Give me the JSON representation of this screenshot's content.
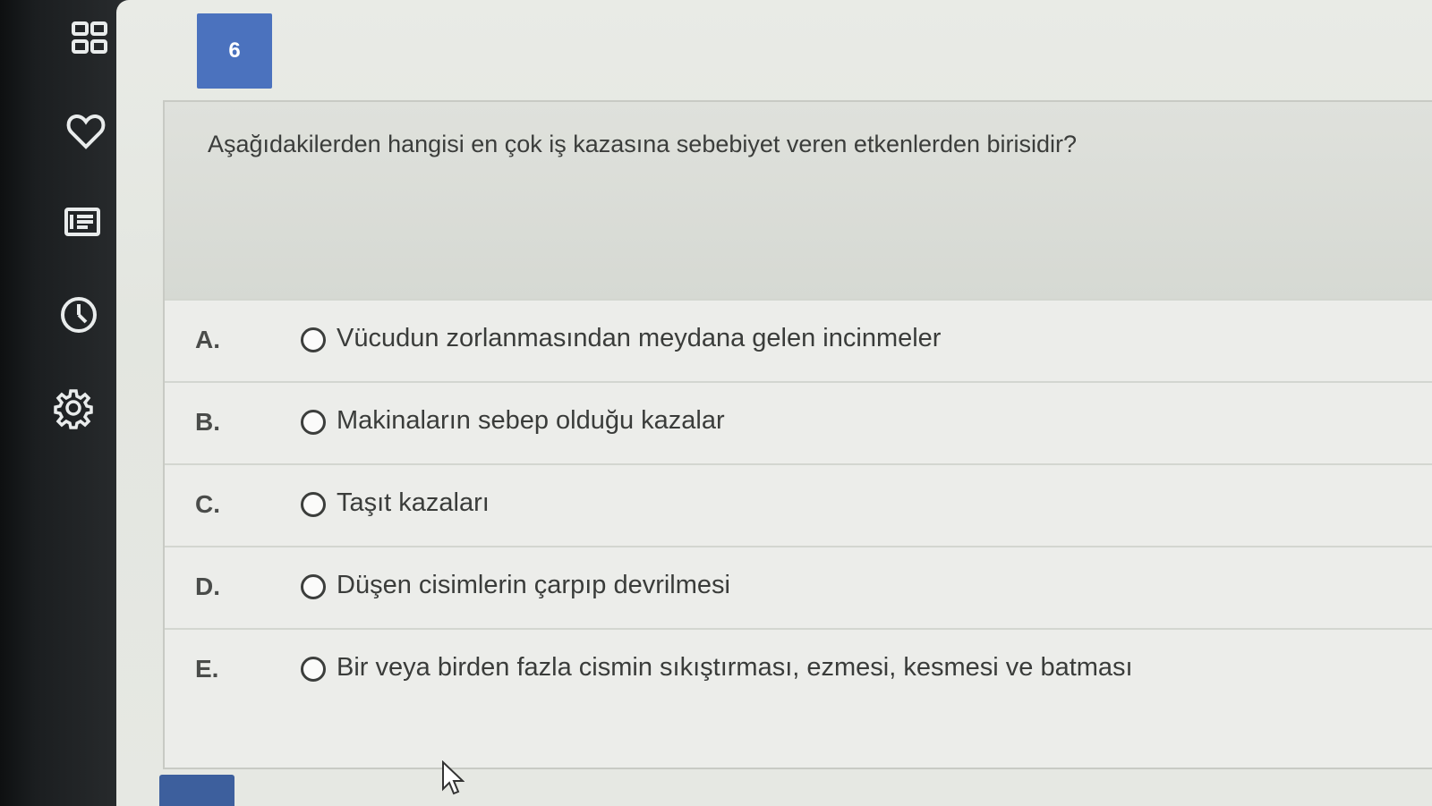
{
  "sidebar": {
    "items": [
      {
        "icon": "grid-icon",
        "name": "dashboard"
      },
      {
        "icon": "heart-icon",
        "name": "favorites"
      },
      {
        "icon": "newspaper-icon",
        "name": "articles"
      },
      {
        "icon": "clock-icon",
        "name": "history"
      },
      {
        "icon": "gear-icon",
        "name": "settings"
      }
    ]
  },
  "question": {
    "number": "6",
    "text": "Aşağıdakilerden hangisi en çok iş kazasına sebebiyet veren etkenlerden birisidir?"
  },
  "options": [
    {
      "letter": "A.",
      "text": "Vücudun zorlanmasından meydana gelen incinmeler"
    },
    {
      "letter": "B.",
      "text": "Makinaların sebep olduğu kazalar"
    },
    {
      "letter": "C.",
      "text": "Taşıt kazaları"
    },
    {
      "letter": "D.",
      "text": "Düşen cisimlerin çarpıp devrilmesi"
    },
    {
      "letter": "E.",
      "text": "Bir veya birden fazla cismin sıkıştırması, ezmesi, kesmesi ve batması"
    }
  ],
  "colors": {
    "accent": "#4b72be",
    "sidebar_bg": "#2c2f30"
  }
}
